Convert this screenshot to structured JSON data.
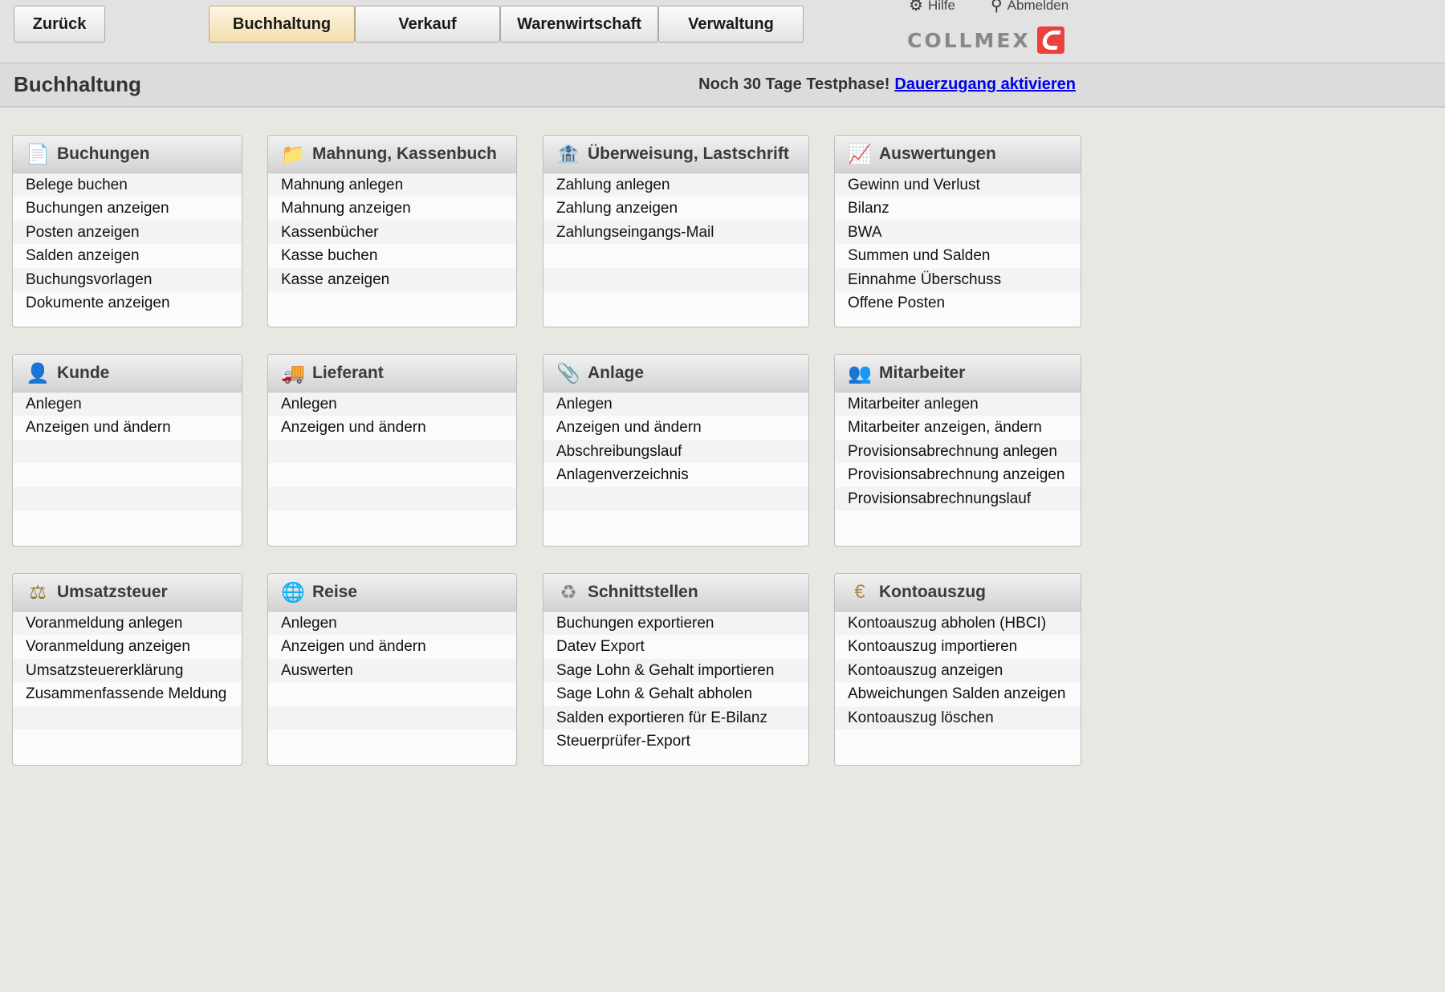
{
  "topbar": {
    "back_label": "Zurück",
    "tabs": [
      {
        "label": "Buchhaltung",
        "active": true
      },
      {
        "label": "Verkauf",
        "active": false
      },
      {
        "label": "Warenwirtschaft",
        "active": false
      },
      {
        "label": "Verwaltung",
        "active": false
      }
    ],
    "help_label": "Hilfe",
    "logout_label": "Abmelden",
    "logo_text": "COLLMEX",
    "brand_color": "#e8413e"
  },
  "header": {
    "title": "Buchhaltung",
    "trial_text": "Noch 30 Tage Testphase!",
    "trial_link": "Dauerzugang aktivieren"
  },
  "panels": [
    {
      "title": "Buchungen",
      "icon": "document-icon",
      "items": [
        "Belege buchen",
        "Buchungen anzeigen",
        "Posten anzeigen",
        "Salden anzeigen",
        "Buchungsvorlagen",
        "Dokumente anzeigen"
      ]
    },
    {
      "title": "Mahnung, Kassenbuch",
      "icon": "folder-icon",
      "items": [
        "Mahnung anlegen",
        "Mahnung anzeigen",
        "Kassenbücher",
        "Kasse buchen",
        "Kasse anzeigen"
      ]
    },
    {
      "title": "Überweisung, Lastschrift",
      "icon": "bank-transfer-icon",
      "items": [
        "Zahlung anlegen",
        "Zahlung anzeigen",
        "Zahlungseingangs-Mail"
      ]
    },
    {
      "title": "Auswertungen",
      "icon": "chart-icon",
      "items": [
        "Gewinn und Verlust",
        "Bilanz",
        "BWA",
        "Summen und Salden",
        "Einnahme Überschuss",
        "Offene Posten"
      ]
    },
    {
      "title": "Kunde",
      "icon": "customer-icon",
      "items": [
        "Anlegen",
        "Anzeigen und ändern"
      ]
    },
    {
      "title": "Lieferant",
      "icon": "truck-icon",
      "items": [
        "Anlegen",
        "Anzeigen und ändern"
      ]
    },
    {
      "title": "Anlage",
      "icon": "asset-icon",
      "items": [
        "Anlegen",
        "Anzeigen und ändern",
        "Abschreibungslauf",
        "Anlagenverzeichnis"
      ]
    },
    {
      "title": "Mitarbeiter",
      "icon": "employees-icon",
      "items": [
        "Mitarbeiter anlegen",
        "Mitarbeiter anzeigen, ändern",
        "Provisionsabrechnung anlegen",
        "Provisionsabrechnung anzeigen",
        "Provisionsabrechnungslauf"
      ]
    },
    {
      "title": "Umsatzsteuer",
      "icon": "scales-icon",
      "items": [
        "Voranmeldung anlegen",
        "Voranmeldung anzeigen",
        "Umsatzsteuererklärung",
        "Zusammenfassende Meldung"
      ]
    },
    {
      "title": "Reise",
      "icon": "globe-icon",
      "items": [
        "Anlegen",
        "Anzeigen und ändern",
        "Auswerten"
      ]
    },
    {
      "title": "Schnittstellen",
      "icon": "interfaces-icon",
      "items": [
        "Buchungen exportieren",
        "Datev Export",
        "Sage Lohn & Gehalt importieren",
        "Sage Lohn & Gehalt abholen",
        "Salden exportieren für E-Bilanz",
        "Steuerprüfer-Export"
      ]
    },
    {
      "title": "Kontoauszug",
      "icon": "euro-coin-icon",
      "items": [
        "Kontoauszug abholen (HBCI)",
        "Kontoauszug importieren",
        "Kontoauszug anzeigen",
        "Abweichungen Salden anzeigen",
        "Kontoauszug löschen"
      ]
    }
  ]
}
